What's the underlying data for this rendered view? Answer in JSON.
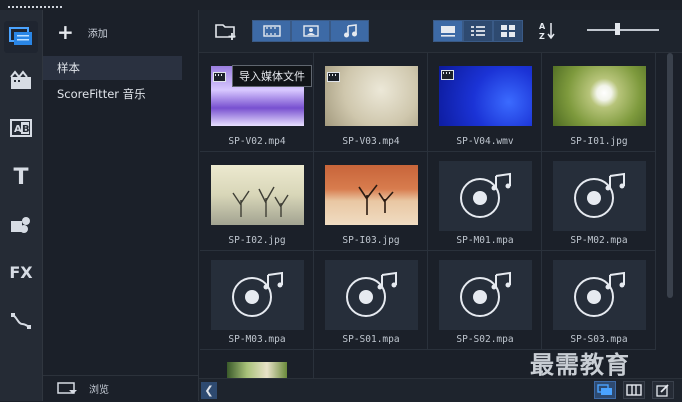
{
  "sidebar": {
    "tools": [
      {
        "name": "media-icon"
      },
      {
        "name": "instant-project-icon"
      },
      {
        "name": "transition-icon"
      },
      {
        "name": "title-icon"
      },
      {
        "name": "graphic-icon"
      },
      {
        "name": "fx-icon",
        "text": "FX"
      },
      {
        "name": "path-icon"
      }
    ]
  },
  "library": {
    "add_label": "添加",
    "folders": [
      "样本",
      "ScoreFitter 音乐"
    ],
    "browse_label": "浏览"
  },
  "toolbar": {
    "tooltip": "导入媒体文件"
  },
  "media": [
    {
      "name": "SP-V02.mp4",
      "kind": "video"
    },
    {
      "name": "SP-V03.mp4",
      "kind": "video"
    },
    {
      "name": "SP-V04.wmv",
      "kind": "video"
    },
    {
      "name": "SP-I01.jpg",
      "kind": "image"
    },
    {
      "name": "SP-I02.jpg",
      "kind": "image"
    },
    {
      "name": "SP-I03.jpg",
      "kind": "image"
    },
    {
      "name": "SP-M01.mpa",
      "kind": "audio"
    },
    {
      "name": "SP-M02.mpa",
      "kind": "audio"
    },
    {
      "name": "SP-M03.mpa",
      "kind": "audio"
    },
    {
      "name": "SP-S01.mpa",
      "kind": "audio"
    },
    {
      "name": "SP-S02.mpa",
      "kind": "audio"
    },
    {
      "name": "SP-S03.mpa",
      "kind": "audio"
    },
    {
      "name": "",
      "kind": "video-partial"
    }
  ],
  "watermark": "最需教育",
  "colors": {
    "accent": "#3d6aa6",
    "panel": "#1b2029",
    "bar": "#252b35"
  }
}
